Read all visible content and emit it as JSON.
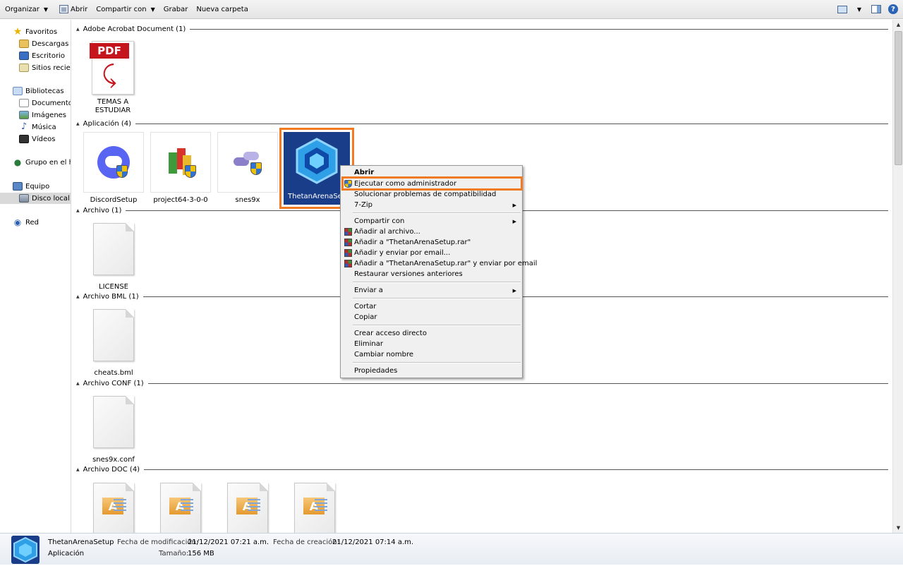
{
  "toolbar": {
    "organize": "Organizar",
    "open": "Abrir",
    "share": "Compartir con",
    "burn": "Grabar",
    "new_folder": "Nueva carpeta",
    "help": "?"
  },
  "nav": {
    "favorites": "Favoritos",
    "downloads": "Descargas",
    "desktop": "Escritorio",
    "recent": "Sitios recient",
    "libraries": "Bibliotecas",
    "documents": "Documentos",
    "images": "Imágenes",
    "music": "Música",
    "videos": "Vídeos",
    "homegroup": "Grupo en el ho",
    "computer": "Equipo",
    "local_disk": "Disco local (C",
    "network": "Red"
  },
  "groups": {
    "pdf": "Adobe Acrobat Document (1)",
    "app": "Aplicación (4)",
    "file": "Archivo (1)",
    "bml": "Archivo BML (1)",
    "conf": "Archivo CONF (1)",
    "doc": "Archivo DOC (4)"
  },
  "files": {
    "pdf_name": "TEMAS A ESTUDIAR",
    "pdf_band": "PDF",
    "discord": "DiscordSetup",
    "project64": "project64-3-0-0",
    "snes9x": "snes9x",
    "thetan": "ThetanArenaSetup",
    "license": "LICENSE",
    "cheats": "cheats.bml",
    "snesconf": "snes9x.conf"
  },
  "context_menu": {
    "open": "Abrir",
    "run_admin": "Ejecutar como administrador",
    "compat": "Solucionar problemas de compatibilidad",
    "zip": "7-Zip",
    "share": "Compartir con",
    "add_archive": "Añadir al archivo...",
    "add_rar": "Añadir a \"ThetanArenaSetup.rar\"",
    "add_email": "Añadir y enviar por email...",
    "add_rar_email": "Añadir a \"ThetanArenaSetup.rar\" y enviar por email",
    "restore": "Restaurar versiones anteriores",
    "send_to": "Enviar a",
    "cut": "Cortar",
    "copy": "Copiar",
    "shortcut": "Crear acceso directo",
    "delete": "Eliminar",
    "rename": "Cambiar nombre",
    "properties": "Propiedades"
  },
  "details": {
    "name": "ThetanArenaSetup",
    "type": "Aplicación",
    "modified_label": "Fecha de modificación:",
    "modified_value": "21/12/2021 07:21 a.m.",
    "created_label": "Fecha de creación:",
    "created_value": "21/12/2021 07:14 a.m.",
    "size_label": "Tamaño:",
    "size_value": "156 MB"
  },
  "colors": {
    "highlight": "#f07b23",
    "selected_bg": "#1a3d8a"
  }
}
